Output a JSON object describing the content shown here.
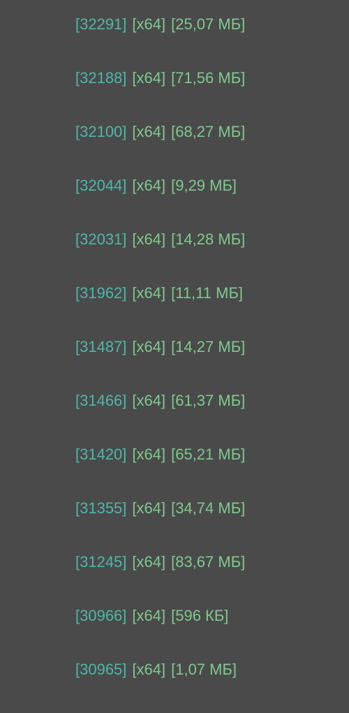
{
  "list": {
    "items": [
      {
        "id": "[32291]",
        "arch": "[x64]",
        "size": "[25,07 МБ]"
      },
      {
        "id": "[32188]",
        "arch": "[x64]",
        "size": "[71,56 МБ]"
      },
      {
        "id": "[32100]",
        "arch": "[x64]",
        "size": "[68,27 МБ]"
      },
      {
        "id": "[32044]",
        "arch": "[x64]",
        "size": "[9,29 МБ]"
      },
      {
        "id": "[32031]",
        "arch": "[x64]",
        "size": "[14,28 МБ]"
      },
      {
        "id": "[31962]",
        "arch": "[x64]",
        "size": "[11,11 МБ]"
      },
      {
        "id": "[31487]",
        "arch": "[x64]",
        "size": "[14,27 МБ]"
      },
      {
        "id": "[31466]",
        "arch": "[x64]",
        "size": "[61,37 МБ]"
      },
      {
        "id": "[31420]",
        "arch": "[x64]",
        "size": "[65,21 МБ]"
      },
      {
        "id": "[31355]",
        "arch": "[x64]",
        "size": "[34,74 МБ]"
      },
      {
        "id": "[31245]",
        "arch": "[x64]",
        "size": "[83,67 МБ]"
      },
      {
        "id": "[30966]",
        "arch": "[x64]",
        "size": "[596 КБ]"
      },
      {
        "id": "[30965]",
        "arch": "[x64]",
        "size": "[1,07 МБ]"
      }
    ]
  }
}
